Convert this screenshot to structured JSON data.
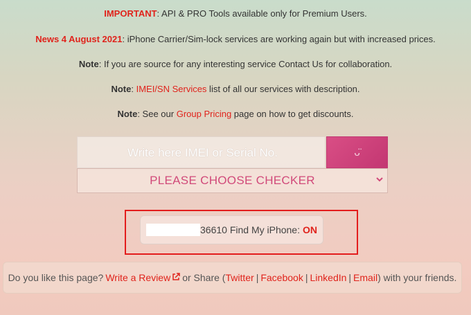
{
  "notices": [
    {
      "label": "IMPORTANT",
      "text": ": API & PRO Tools available only for Premium Users."
    },
    {
      "label": "News 4 August 2021",
      "text": ": iPhone Carrier/Sim-lock services are working again but with increased prices."
    },
    {
      "label": "Note",
      "text": ": If you are source for any interesting service Contact Us for collaboration."
    },
    {
      "label": "Note",
      "link": "IMEI/SN Services",
      "text": " list of all our services with description."
    },
    {
      "label": "Note",
      "pre": ": See our ",
      "link": "Group Pricing",
      "text": " page on how to get discounts."
    }
  ],
  "imei": {
    "placeholder": "Write here IMEI or Serial No.",
    "button_icon": "smile-icon",
    "button_glyph": "ᴗ̈"
  },
  "checker": {
    "selected": "PLEASE CHOOSE CHECKER",
    "icon": "chevron-down-icon"
  },
  "result": {
    "imei_suffix": "36610",
    "label": "Find My iPhone:",
    "status": "ON",
    "status_color": "#e0231c"
  },
  "share": {
    "prefix": "Do you like this page?",
    "review": "Write a Review",
    "or_share": "or Share (",
    "twitter": "Twitter",
    "sep1": "|",
    "facebook": "Facebook",
    "sep2": "|",
    "linkedin": "LinkedIn",
    "sep3": "|",
    "email": "Email",
    "suffix": ") with your friends."
  },
  "colors": {
    "accent": "#e0231c",
    "pink": "#d14a7a"
  }
}
